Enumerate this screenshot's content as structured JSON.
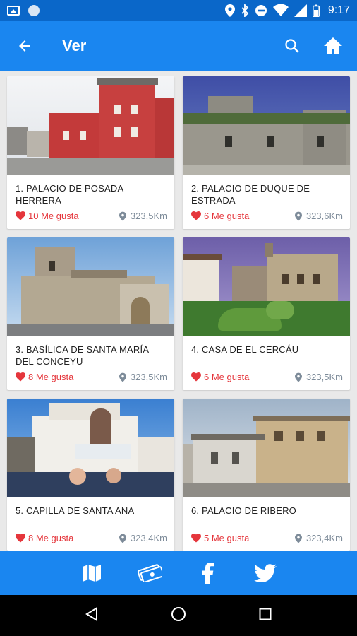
{
  "status": {
    "time": "9:17"
  },
  "appbar": {
    "title": "Ver"
  },
  "places": [
    {
      "title": "1. PALACIO DE POSADA HERRERA",
      "likes": "10 Me gusta",
      "distance": "323,5Km"
    },
    {
      "title": "2. PALACIO DE DUQUE DE ESTRADA",
      "likes": "6 Me gusta",
      "distance": "323,6Km"
    },
    {
      "title": "3. BASÍLICA DE SANTA MARÍA DEL CONCEYU",
      "likes": "8 Me gusta",
      "distance": "323,5Km"
    },
    {
      "title": "4. CASA DE EL CERCÁU",
      "likes": "6 Me gusta",
      "distance": "323,5Km"
    },
    {
      "title": "5. CAPILLA DE SANTA ANA",
      "likes": "8 Me gusta",
      "distance": "323,4Km"
    },
    {
      "title": "6. PALACIO DE RIBERO",
      "likes": "5 Me gusta",
      "distance": "323,4Km"
    }
  ],
  "colors": {
    "primary": "#1a86f0",
    "status_bar": "#0a67c9",
    "like": "#e5363c",
    "distance": "#7d8b99"
  },
  "bottom_icons": [
    "map-icon",
    "money-icon",
    "facebook-icon",
    "twitter-icon"
  ]
}
